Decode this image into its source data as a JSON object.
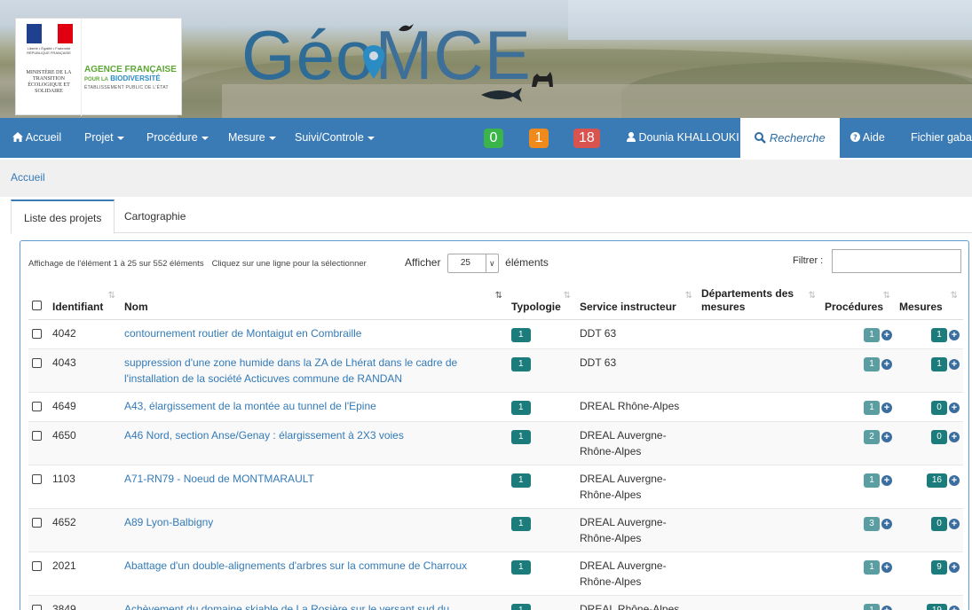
{
  "header": {
    "ministry_motto": "Liberté • Égalité • Fraternité RÉPUBLIQUE FRANÇAISE",
    "ministry_name": "MINISTÈRE DE LA TRANSITION ÉCOLOGIQUE ET SOLIDAIRE",
    "afb_line1": "AGENCE FRANÇAISE",
    "afb_line2_prefix": "POUR LA",
    "afb_line2": "BIODIVERSITÉ",
    "afb_line3": "ÉTABLISSEMENT PUBLIC DE L'ÉTAT",
    "app_title_a": "Géo",
    "app_title_b": "MCE"
  },
  "nav": {
    "accueil": "Accueil",
    "projet": "Projet",
    "procedure": "Procédure",
    "mesure": "Mesure",
    "suivi": "Suivi/Controle",
    "badge_green": "0",
    "badge_orange": "1",
    "badge_red": "18",
    "user": "Dounia KHALLOUKI",
    "recherche": "Recherche",
    "aide": "Aide",
    "gabarit": "Fichier gabar",
    "colors": {
      "bar": "#3a7bb5",
      "green": "#3bb54a",
      "orange": "#f08a1c",
      "red": "#d9534f"
    }
  },
  "breadcrumb": {
    "accueil": "Accueil"
  },
  "tabs": {
    "projets": "Liste des projets",
    "carto": "Cartographie"
  },
  "table_controls": {
    "info": "Affichage de l'élément 1 à 25 sur 552 éléments",
    "hint": "Cliquez sur une ligne pour la sélectionner",
    "afficher": "Afficher",
    "page_size": "25",
    "elements": "éléments",
    "filtrer": "Filtrer :"
  },
  "columns": {
    "identifiant": "Identifiant",
    "nom": "Nom",
    "typologie": "Typologie",
    "service": "Service instructeur",
    "departements": "Départements des mesures",
    "procedures": "Procédures",
    "mesures": "Mesures"
  },
  "rows": [
    {
      "id": "4042",
      "nom": "contournement routier de Montaigut en Combraille",
      "typ": "1",
      "service": "DDT 63",
      "proc": "1",
      "mes": "1"
    },
    {
      "id": "4043",
      "nom": "suppression d'une zone humide dans la ZA de Lhérat dans le cadre de l'installation de la société Acticuves commune de RANDAN",
      "typ": "1",
      "service": "DDT 63",
      "proc": "1",
      "mes": "1"
    },
    {
      "id": "4649",
      "nom": "A43, élargissement de la montée au tunnel de l'Epine",
      "typ": "1",
      "service": "DREAL Rhône-Alpes",
      "proc": "1",
      "mes": "0"
    },
    {
      "id": "4650",
      "nom": "A46 Nord, section Anse/Genay : élargissement à 2X3 voies",
      "typ": "1",
      "service": "DREAL Auvergne-Rhône-Alpes",
      "proc": "2",
      "mes": "0"
    },
    {
      "id": "1103",
      "nom": "A71-RN79 - Noeud de MONTMARAULT",
      "typ": "1",
      "service": "DREAL Auvergne-Rhône-Alpes",
      "proc": "1",
      "mes": "16"
    },
    {
      "id": "4652",
      "nom": "A89 Lyon-Balbigny",
      "typ": "1",
      "service": "DREAL Auvergne-Rhône-Alpes",
      "proc": "3",
      "mes": "0"
    },
    {
      "id": "2021",
      "nom": "Abattage d'un double-alignements d'arbres sur la commune de Charroux",
      "typ": "1",
      "service": "DREAL Auvergne-Rhône-Alpes",
      "proc": "1",
      "mes": "9"
    },
    {
      "id": "3849",
      "nom": "Achèvement du domaine skiable de La Rosière sur le versant sud du Montvalezan",
      "typ": "1",
      "service": "DREAL Rhône-Alpes",
      "proc": "1",
      "mes": "19"
    }
  ]
}
